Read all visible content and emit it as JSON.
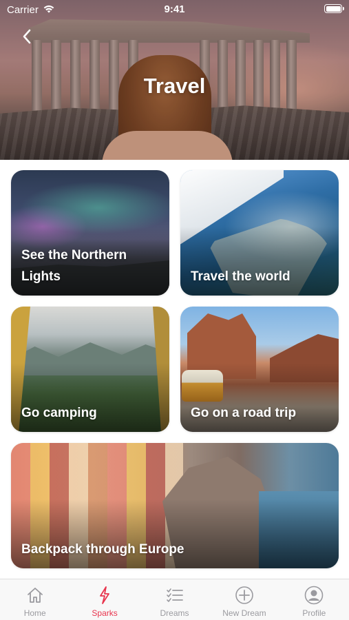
{
  "status_bar": {
    "carrier": "Carrier",
    "time": "9:41"
  },
  "header": {
    "title": "Travel"
  },
  "cards": [
    {
      "id": "lights",
      "label": "See the Northern Lights"
    },
    {
      "id": "world",
      "label": "Travel the world"
    },
    {
      "id": "camp",
      "label": "Go camping"
    },
    {
      "id": "road",
      "label": "Go on a road trip"
    },
    {
      "id": "europe",
      "label": "Backpack through Europe"
    }
  ],
  "tab_bar": {
    "items": [
      {
        "label": "Home",
        "icon": "house-icon"
      },
      {
        "label": "Sparks",
        "icon": "lightning-icon"
      },
      {
        "label": "Dreams",
        "icon": "checklist-icon"
      },
      {
        "label": "New Dream",
        "icon": "plus-circle-icon"
      },
      {
        "label": "Profile",
        "icon": "person-circle-icon"
      }
    ],
    "active": "Sparks"
  },
  "colors": {
    "accent": "#e8344d",
    "inactive": "#9a9a9f",
    "tab_background": "#f8f8f8"
  }
}
